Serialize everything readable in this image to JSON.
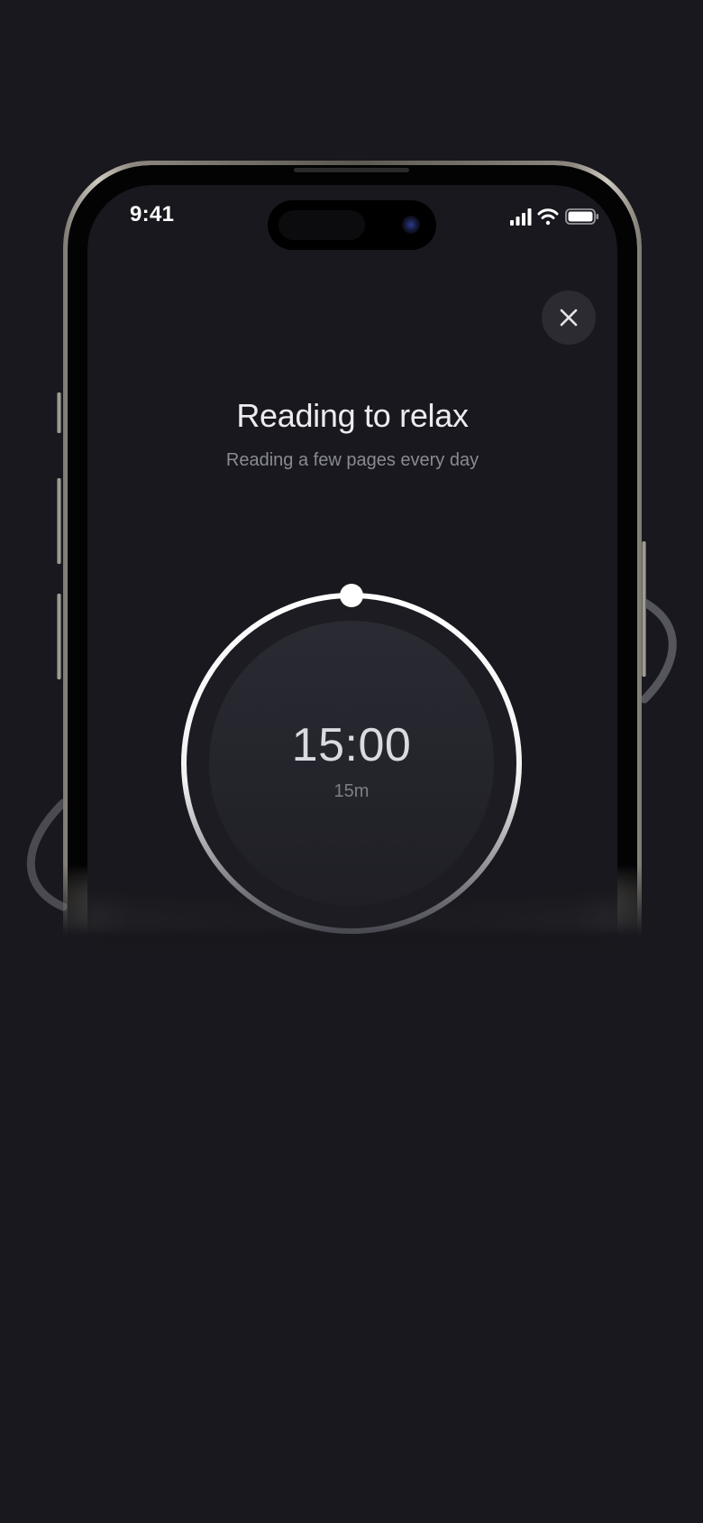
{
  "status_bar": {
    "time": "9:41",
    "icons": [
      "signal-icon",
      "wifi-icon",
      "battery-icon"
    ]
  },
  "header": {
    "close_icon": "close-icon"
  },
  "habit": {
    "title": "Reading to relax",
    "subtitle": "Reading a few pages every day"
  },
  "timer": {
    "value": "15:00",
    "duration_label": "15m"
  },
  "colors": {
    "background": "#18181e",
    "ring": "#ffffff",
    "close_button": "#2b2b31"
  }
}
